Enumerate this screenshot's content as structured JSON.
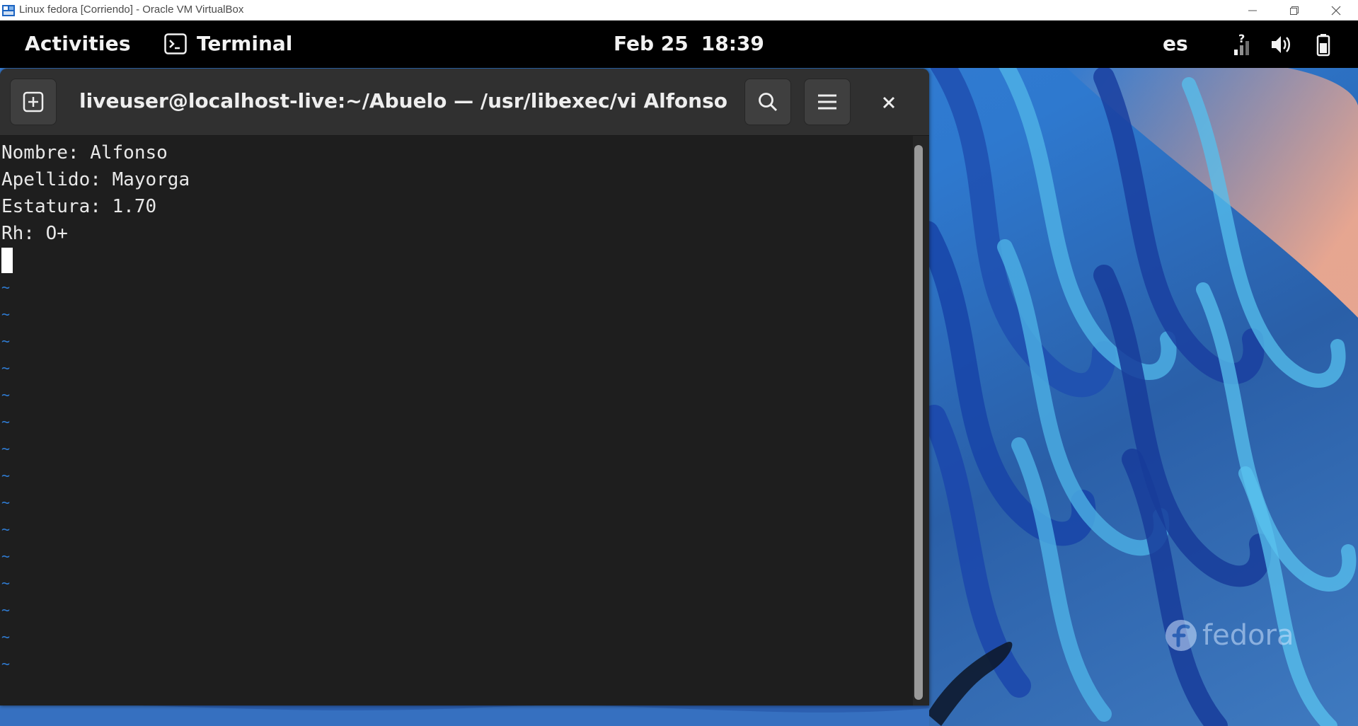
{
  "vbox": {
    "title": "Linux fedora [Corriendo] - Oracle VM VirtualBox",
    "icon": "virtualbox-icon",
    "controls": [
      "minimize-icon",
      "restore-icon",
      "close-icon"
    ]
  },
  "topbar": {
    "activities_label": "Activities",
    "app_name": "Terminal",
    "app_icon": "terminal-icon",
    "date": "Feb 25",
    "time": "18:39",
    "keyboard_layout": "es",
    "tray_icons": [
      "network-question-icon",
      "volume-icon",
      "battery-icon"
    ]
  },
  "terminal": {
    "title": "liveuser@localhost-live:~/Abuelo — /usr/libexec/vi Alfonso",
    "buttons": {
      "new_tab_icon": "new-tab-icon",
      "search_icon": "search-icon",
      "menu_icon": "hamburger-menu-icon",
      "close_icon": "close-icon"
    },
    "lines": [
      "Nombre: Alfonso",
      "Apellido: Mayorga",
      "Estatura: 1.70",
      "Rh: O+"
    ],
    "tilde_char": "~",
    "tilde_count": 15
  },
  "desktop": {
    "logo_text": "fedora"
  },
  "colors": {
    "terminal_bg": "#1e1e1e",
    "headerbar_bg": "#303030",
    "vi_tilde": "#2f7bd1",
    "topbar_bg": "#000000"
  }
}
